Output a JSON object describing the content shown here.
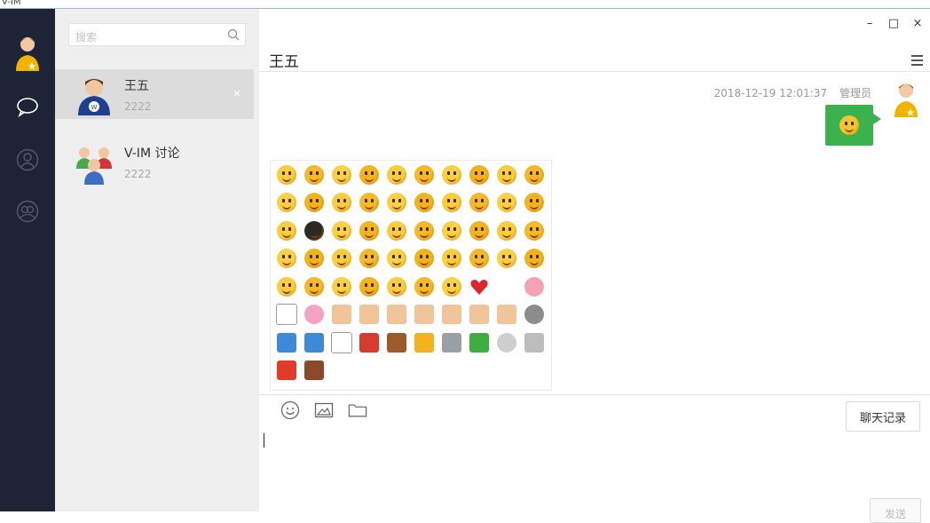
{
  "app": {
    "window_title": "V-IM"
  },
  "search": {
    "placeholder": "搜索"
  },
  "sessions": [
    {
      "name": "王五",
      "preview": "2222",
      "active": true,
      "close_label": "×"
    },
    {
      "name": "V-IM 讨论",
      "preview": "2222",
      "active": false
    }
  ],
  "chat": {
    "title": "王五",
    "messages": [
      {
        "time": "2018-12-19 12:01:37",
        "sender": "管理员",
        "content": "emoji-face"
      }
    ]
  },
  "window_controls": {
    "minimize": "–",
    "maximize": "□",
    "close": "×"
  },
  "buttons": {
    "history": "聊天记录",
    "send": "发送"
  },
  "colors": {
    "rail": "#1d2435",
    "session_bg": "#efefef",
    "active_session": "#dcdcdc",
    "bubble": "#3bb24e"
  }
}
